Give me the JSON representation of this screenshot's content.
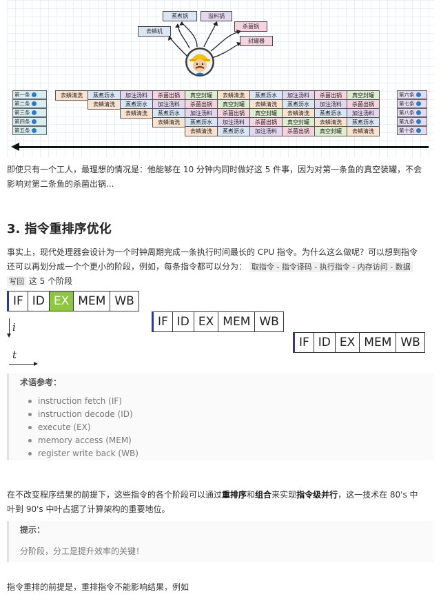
{
  "diagram": {
    "bubbles": [
      "蒸煮锅",
      "溢料锅",
      "去鳞机",
      "杀菌锅",
      "封罐器"
    ],
    "fish_left": [
      "第一条",
      "第二条",
      "第三条",
      "第四条",
      "第五条"
    ],
    "fish_right": [
      "第六条",
      "第七条",
      "第八条",
      "第九条",
      "第十条"
    ],
    "rows": [
      [
        "去鳞清洗",
        "蒸煮沥水",
        "加注汤料",
        "杀菌出锅",
        "真空封罐",
        "去鳞清洗",
        "蒸煮沥水",
        "加注汤料",
        "杀菌出锅",
        "真空封罐"
      ],
      [
        "去鳞清洗",
        "蒸煮沥水",
        "加注汤料",
        "杀菌出锅",
        "真空封罐",
        "去鳞清洗",
        "蒸煮沥水",
        "加注汤料",
        "杀菌出锅"
      ],
      [
        "去鳞清洗",
        "蒸煮沥水",
        "加注汤料",
        "杀菌出锅",
        "真空封罐",
        "去鳞清洗",
        "蒸煮沥水",
        "加注汤料"
      ],
      [
        "去鳞清洗",
        "蒸煮沥水",
        "加注汤料",
        "杀菌出锅",
        "真空封罐",
        "去鳞清洗",
        "蒸煮沥水"
      ],
      [
        "去鳞清洗",
        "蒸煮沥水",
        "加注汤料",
        "杀菌出锅",
        "真空封罐",
        "去鳞清洗"
      ]
    ]
  },
  "intro": {
    "line1": "即使只有一个工人，最理想的情况是：他能够在 10 分钟内同时做好这 5 件事，因为对第一条鱼的真空装罐，不会",
    "line2": "影响对第二条鱼的杀菌出锅..."
  },
  "section": {
    "title": "3. 指令重排序优化",
    "p1_a": "事实上，现代处理器会设计为一个时钟周期完成一条执行时间最长的 CPU 指令。为什么这么做呢？可以想到指令",
    "p1_b": "还可以再划分成一个个更小的阶段，例如，每条指令都可以分为：",
    "p1_code": "取指令 - 指令译码 - 执行指令 - 内存访问 - 数据",
    "p1_code2": "写回",
    "p1_tail": "这 5 个阶段"
  },
  "pipeline": {
    "stages": [
      "IF",
      "ID",
      "EX",
      "MEM",
      "WB"
    ],
    "axis_i": "i",
    "axis_t": "t"
  },
  "terms": {
    "title": "术语参考：",
    "items": [
      "instruction fetch (IF)",
      "instruction decode (ID)",
      "execute (EX)",
      "memory access (MEM)",
      "register write back (WB)"
    ]
  },
  "para2": {
    "a": "在不改变程序结果的前提下，这些指令的各个阶段可以通过",
    "b1": "重排序",
    "c": "和",
    "b2": "组合",
    "d": "来实现",
    "b3": "指令级并行",
    "e": "，这一技术在 80's 中",
    "line2": "叶到 90's 中叶占据了计算架构的重要地位。"
  },
  "tip": {
    "title": "提示：",
    "text": "分阶段，分工是提升效率的关键！"
  },
  "last": {
    "text": "指令重排的前提是，重排指令不能影响结果，例如"
  }
}
